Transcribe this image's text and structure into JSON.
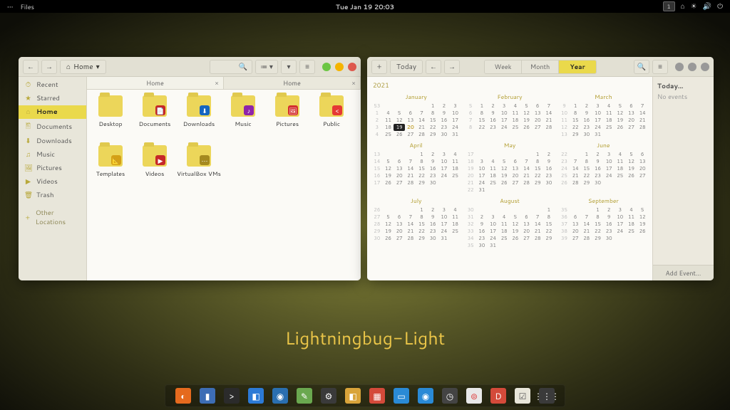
{
  "topbar": {
    "left": "•••",
    "label": "Files",
    "clock": "Tue Jan 19  20:03",
    "badge": "1"
  },
  "traffic": {
    "min": "#6cc644",
    "max": "#f5b400",
    "close": "#e05a4f"
  },
  "theme_title": "Lightningbug-Light",
  "files": {
    "path_label": "Home",
    "tabs": [
      {
        "label": "Home",
        "active": true
      },
      {
        "label": "Home",
        "active": false
      }
    ],
    "sidebar": [
      {
        "icon": "⏱",
        "label": "Recent"
      },
      {
        "icon": "★",
        "label": "Starred"
      },
      {
        "icon": "⌂",
        "label": "Home",
        "active": true
      },
      {
        "icon": "🖺",
        "label": "Documents"
      },
      {
        "icon": "⬇",
        "label": "Downloads"
      },
      {
        "icon": "♫",
        "label": "Music"
      },
      {
        "icon": "🖼",
        "label": "Pictures"
      },
      {
        "icon": "▶",
        "label": "Videos"
      },
      {
        "icon": "🗑",
        "label": "Trash"
      },
      {
        "icon": "+",
        "label": "Other Locations",
        "last": true
      }
    ],
    "folders": [
      {
        "name": "Desktop"
      },
      {
        "name": "Documents",
        "badge": "📄",
        "bcolor": "#c62828"
      },
      {
        "name": "Downloads",
        "badge": "⬇",
        "bcolor": "#1565c0"
      },
      {
        "name": "Music",
        "badge": "♪",
        "bcolor": "#8e24aa"
      },
      {
        "name": "Pictures",
        "badge": "🖼",
        "bcolor": "#d32f2f"
      },
      {
        "name": "Public",
        "badge": "<",
        "bcolor": "#e53935"
      },
      {
        "name": "Templates",
        "badge": "📐",
        "bcolor": "#d4a017"
      },
      {
        "name": "Videos",
        "badge": "▶",
        "bcolor": "#c62828"
      },
      {
        "name": "VirtualBox VMs",
        "badge": "⋯",
        "bcolor": "#a58a1f"
      }
    ]
  },
  "calendar": {
    "today_label": "Today",
    "views": [
      "Week",
      "Month",
      "Year"
    ],
    "active_view": "Year",
    "sidebar_header": "Today…",
    "no_events": "No events",
    "add_event": "Add Event…",
    "year": "2021",
    "highlight": {
      "month": 0,
      "day": 19
    },
    "months": [
      {
        "name": "January",
        "first_dow": 4,
        "days": 31,
        "weeks": [
          53,
          1,
          2,
          3,
          4
        ]
      },
      {
        "name": "February",
        "first_dow": 0,
        "days": 28,
        "weeks": [
          5,
          6,
          7,
          8
        ]
      },
      {
        "name": "March",
        "first_dow": 0,
        "days": 31,
        "weeks": [
          9,
          10,
          11,
          12,
          13
        ]
      },
      {
        "name": "April",
        "first_dow": 3,
        "days": 30,
        "weeks": [
          13,
          14,
          15,
          16,
          17
        ]
      },
      {
        "name": "May",
        "first_dow": 5,
        "days": 31,
        "weeks": [
          17,
          18,
          19,
          20,
          21,
          22
        ]
      },
      {
        "name": "June",
        "first_dow": 1,
        "days": 30,
        "weeks": [
          22,
          23,
          24,
          25,
          26
        ]
      },
      {
        "name": "July",
        "first_dow": 3,
        "days": 31,
        "weeks": [
          26,
          27,
          28,
          29,
          30
        ]
      },
      {
        "name": "August",
        "first_dow": 6,
        "days": 31,
        "weeks": [
          30,
          31,
          32,
          33,
          34,
          35
        ]
      },
      {
        "name": "September",
        "first_dow": 2,
        "days": 30,
        "weeks": [
          35,
          36,
          37,
          38,
          39
        ]
      }
    ]
  },
  "dock": [
    {
      "c": "#e56a1e",
      "g": "◐"
    },
    {
      "c": "#3d6db5",
      "g": "▮"
    },
    {
      "c": "#2b2b2b",
      "g": ">"
    },
    {
      "c": "#2c7ad6",
      "g": "◧"
    },
    {
      "c": "#2a6fb0",
      "g": "◉"
    },
    {
      "c": "#6aa84f",
      "g": "✎"
    },
    {
      "c": "#3a3a3a",
      "g": "⚙"
    },
    {
      "c": "#d9a43a",
      "g": "◧"
    },
    {
      "c": "#d44a3a",
      "g": "▦"
    },
    {
      "c": "#2a8ad6",
      "g": "▭"
    },
    {
      "c": "#2a8ad6",
      "g": "◉"
    },
    {
      "c": "#444",
      "g": "◷"
    },
    {
      "c": "#e8e8e8",
      "g": "⊚",
      "fg": "#d44"
    },
    {
      "c": "#d44a3a",
      "g": "D"
    },
    {
      "c": "#e8e6da",
      "g": "☑",
      "fg": "#555"
    },
    {
      "c": "#3a3a3a",
      "g": "⋮⋮⋮"
    }
  ]
}
